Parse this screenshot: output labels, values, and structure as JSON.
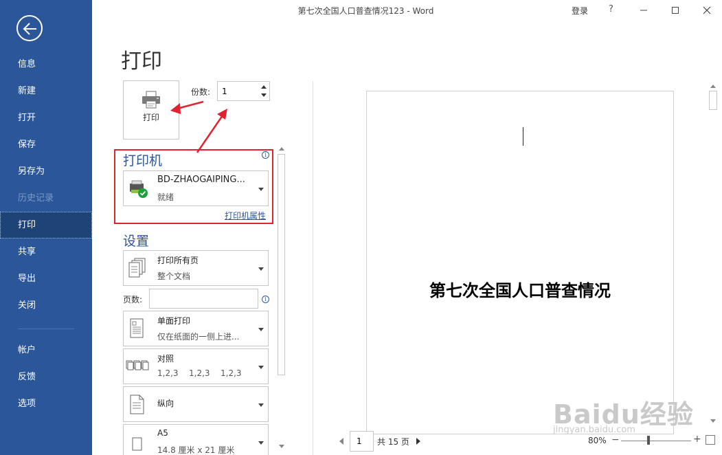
{
  "window": {
    "title": "第七次全国人口普查情况123 - Word",
    "login": "登录",
    "help": "?"
  },
  "sidebar": {
    "items": [
      {
        "label": "信息"
      },
      {
        "label": "新建"
      },
      {
        "label": "打开"
      },
      {
        "label": "保存"
      },
      {
        "label": "另存为"
      },
      {
        "label": "历史记录",
        "disabled": true
      },
      {
        "label": "打印",
        "active": true
      },
      {
        "label": "共享"
      },
      {
        "label": "导出"
      },
      {
        "label": "关闭"
      }
    ],
    "bottom_items": [
      {
        "label": "帐户"
      },
      {
        "label": "反馈"
      },
      {
        "label": "选项"
      }
    ]
  },
  "print": {
    "page_title": "打印",
    "button_label": "打印",
    "copies_label": "份数:",
    "copies_value": "1"
  },
  "printer": {
    "heading": "打印机",
    "name": "BD-ZHAOGAIPING...",
    "status": "就绪",
    "properties_link": "打印机属性"
  },
  "settings": {
    "heading": "设置",
    "range": {
      "main": "打印所有页",
      "sub": "整个文档"
    },
    "pages_label": "页数:",
    "pages_value": "",
    "sides": {
      "main": "单面打印",
      "sub": "仅在纸面的一侧上进..."
    },
    "collate": {
      "main": "对照",
      "sub": [
        "1,2,3",
        "1,2,3",
        "1,2,3"
      ]
    },
    "orientation": {
      "main": "纵向"
    },
    "paper": {
      "main": "A5",
      "sub": "14.8 厘米 x 21 厘米"
    }
  },
  "preview": {
    "doc_title": "第七次全国人口普查情况",
    "current_page": "1",
    "total_pages": "共 15 页",
    "zoom": "80%"
  },
  "watermark": {
    "text": "Baidu经验",
    "url": "jingyan.baidu.com"
  },
  "colors": {
    "sidebar": "#2b579a",
    "accent": "#2b579a",
    "highlight": "#e0232e"
  }
}
